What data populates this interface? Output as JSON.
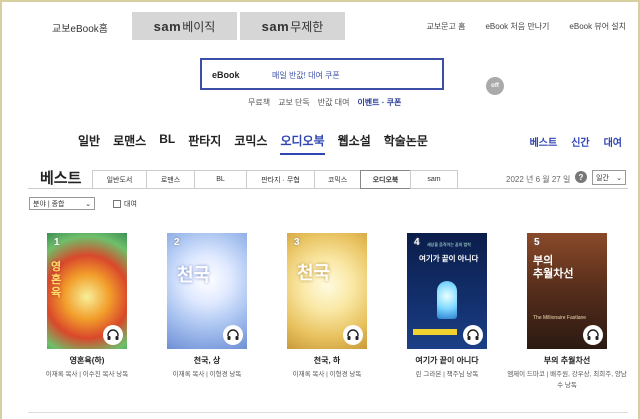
{
  "header": {
    "home_link": "교보eBook홈",
    "sam_tab1_brand": "sam",
    "sam_tab1_label": "베이직",
    "sam_tab2_brand": "sam",
    "sam_tab2_label": "무제한",
    "util_links": [
      "교보문고 홈",
      "eBook 처음 만나기",
      "eBook 뷰어 설치"
    ]
  },
  "search": {
    "label": "eBook",
    "placeholder": "매일 반값! 대여 쿠폰",
    "toggle": "off",
    "quick_links": [
      "무료책",
      "교보 단독",
      "반값 대여",
      "이벤트 · 쿠폰"
    ]
  },
  "genre_nav": {
    "items": [
      "일반",
      "로맨스",
      "BL",
      "판타지",
      "코믹스",
      "오디오북",
      "웹소설",
      "학술논문"
    ],
    "active": "오디오북",
    "right_items": [
      "베스트",
      "신간",
      "대여"
    ]
  },
  "best": {
    "title": "베스트",
    "tabs": [
      "일반도서",
      "로맨스",
      "BL",
      "판타지 · 무협",
      "코믹스",
      "오디오북",
      "sam"
    ],
    "active_tab": "오디오북",
    "date": "2022 년 6 월 27 일",
    "help_icon": "question-icon",
    "period": "일간",
    "filter": "분야 | 종합",
    "rental_label": "대여"
  },
  "books": [
    {
      "rank": "1",
      "title": "영혼육(하)",
      "author": "이재록 목사 | 이수진 목사 낭독",
      "cover_text": "영혼육"
    },
    {
      "rank": "2",
      "title": "천국, 상",
      "author": "이재록 목사 | 이형경 낭독",
      "cover_text": "천국"
    },
    {
      "rank": "3",
      "title": "천국, 하",
      "author": "이재록 목사 | 이형경 낭독",
      "cover_text": "천국"
    },
    {
      "rank": "4",
      "title": "여기가 끝이 아니다",
      "author": "린 그라본 | 책주님 낭독",
      "cover_text": "여기가 끝이 아니다",
      "cover_subtext": "세상을 움직이는 꿈의 법칙"
    },
    {
      "rank": "5",
      "title": "부의 추월차선",
      "author": "엠제이 드마코 | 배주원, 강우상, 최희주, 양남수 낭독",
      "cover_text": "부의\n추월차선",
      "cover_subtext": "The Millionaire Fastlane"
    }
  ],
  "colors": {
    "accent": "#2f46b3",
    "frame": "#d8cfa0",
    "sam_tab_bg": "#d6d6d6"
  }
}
